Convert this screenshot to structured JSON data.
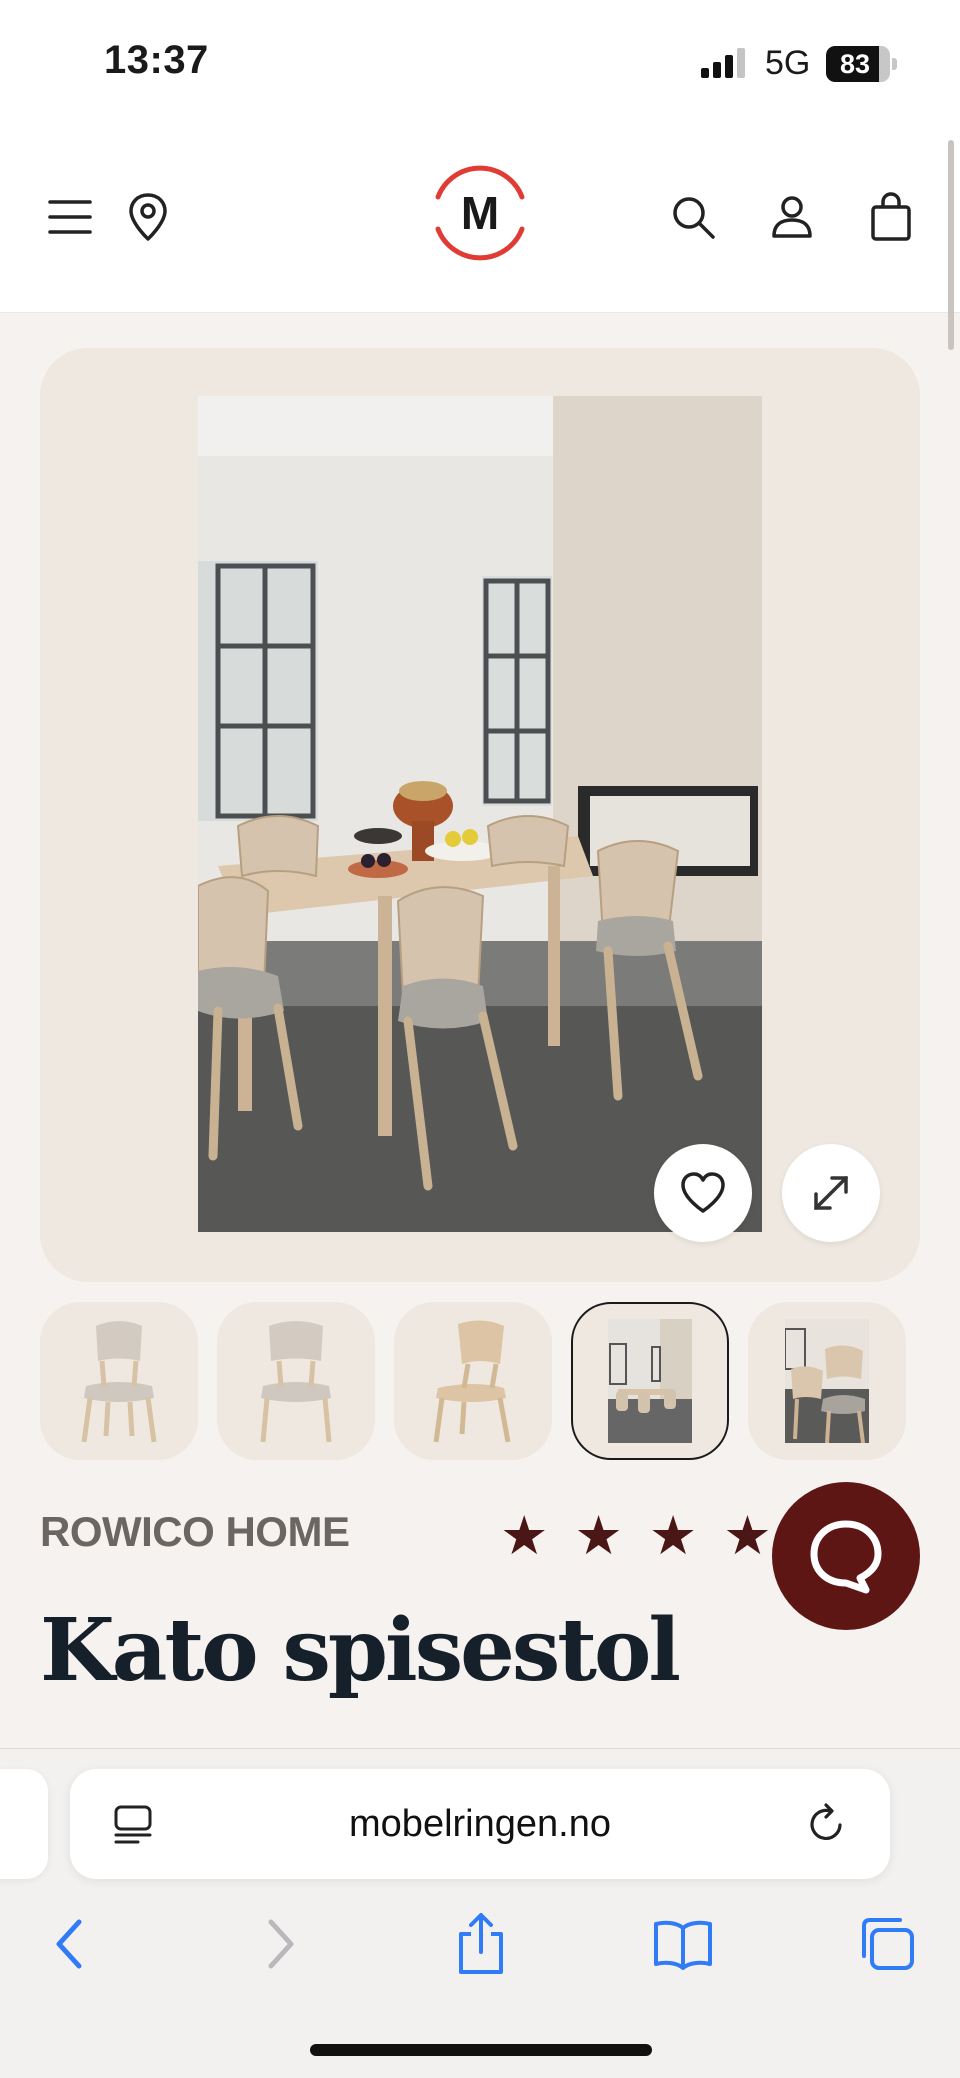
{
  "status_bar": {
    "time": "13:37",
    "network": "5G",
    "battery": "83",
    "battery_level": 0.83
  },
  "header": {
    "logo_letter": "M",
    "icons": [
      "menu-icon",
      "location-pin-icon",
      "search-icon",
      "account-icon",
      "shopping-bag-icon"
    ]
  },
  "product": {
    "brand": "ROWICO HOME",
    "title": "Kato spisestol",
    "rating_stars": 5,
    "stars": [
      "★",
      "★",
      "★",
      "★",
      "★"
    ]
  },
  "gallery": {
    "thumbnail_count": 5,
    "selected_index": 3,
    "actions": [
      "favorite-heart-icon",
      "expand-icon"
    ]
  },
  "browser": {
    "url": "mobelringen.no",
    "icons": [
      "page-menu-icon",
      "reload-icon",
      "back-icon",
      "forward-icon",
      "share-icon",
      "bookmarks-icon",
      "tabs-icon"
    ]
  },
  "colors": {
    "accent_red": "#e03c33",
    "star_color": "#4a1716",
    "chat_bg": "#5e1614",
    "ios_blue": "#2f7cf6",
    "card_bg": "#eee8e0",
    "page_bg": "#f6f2ef"
  }
}
